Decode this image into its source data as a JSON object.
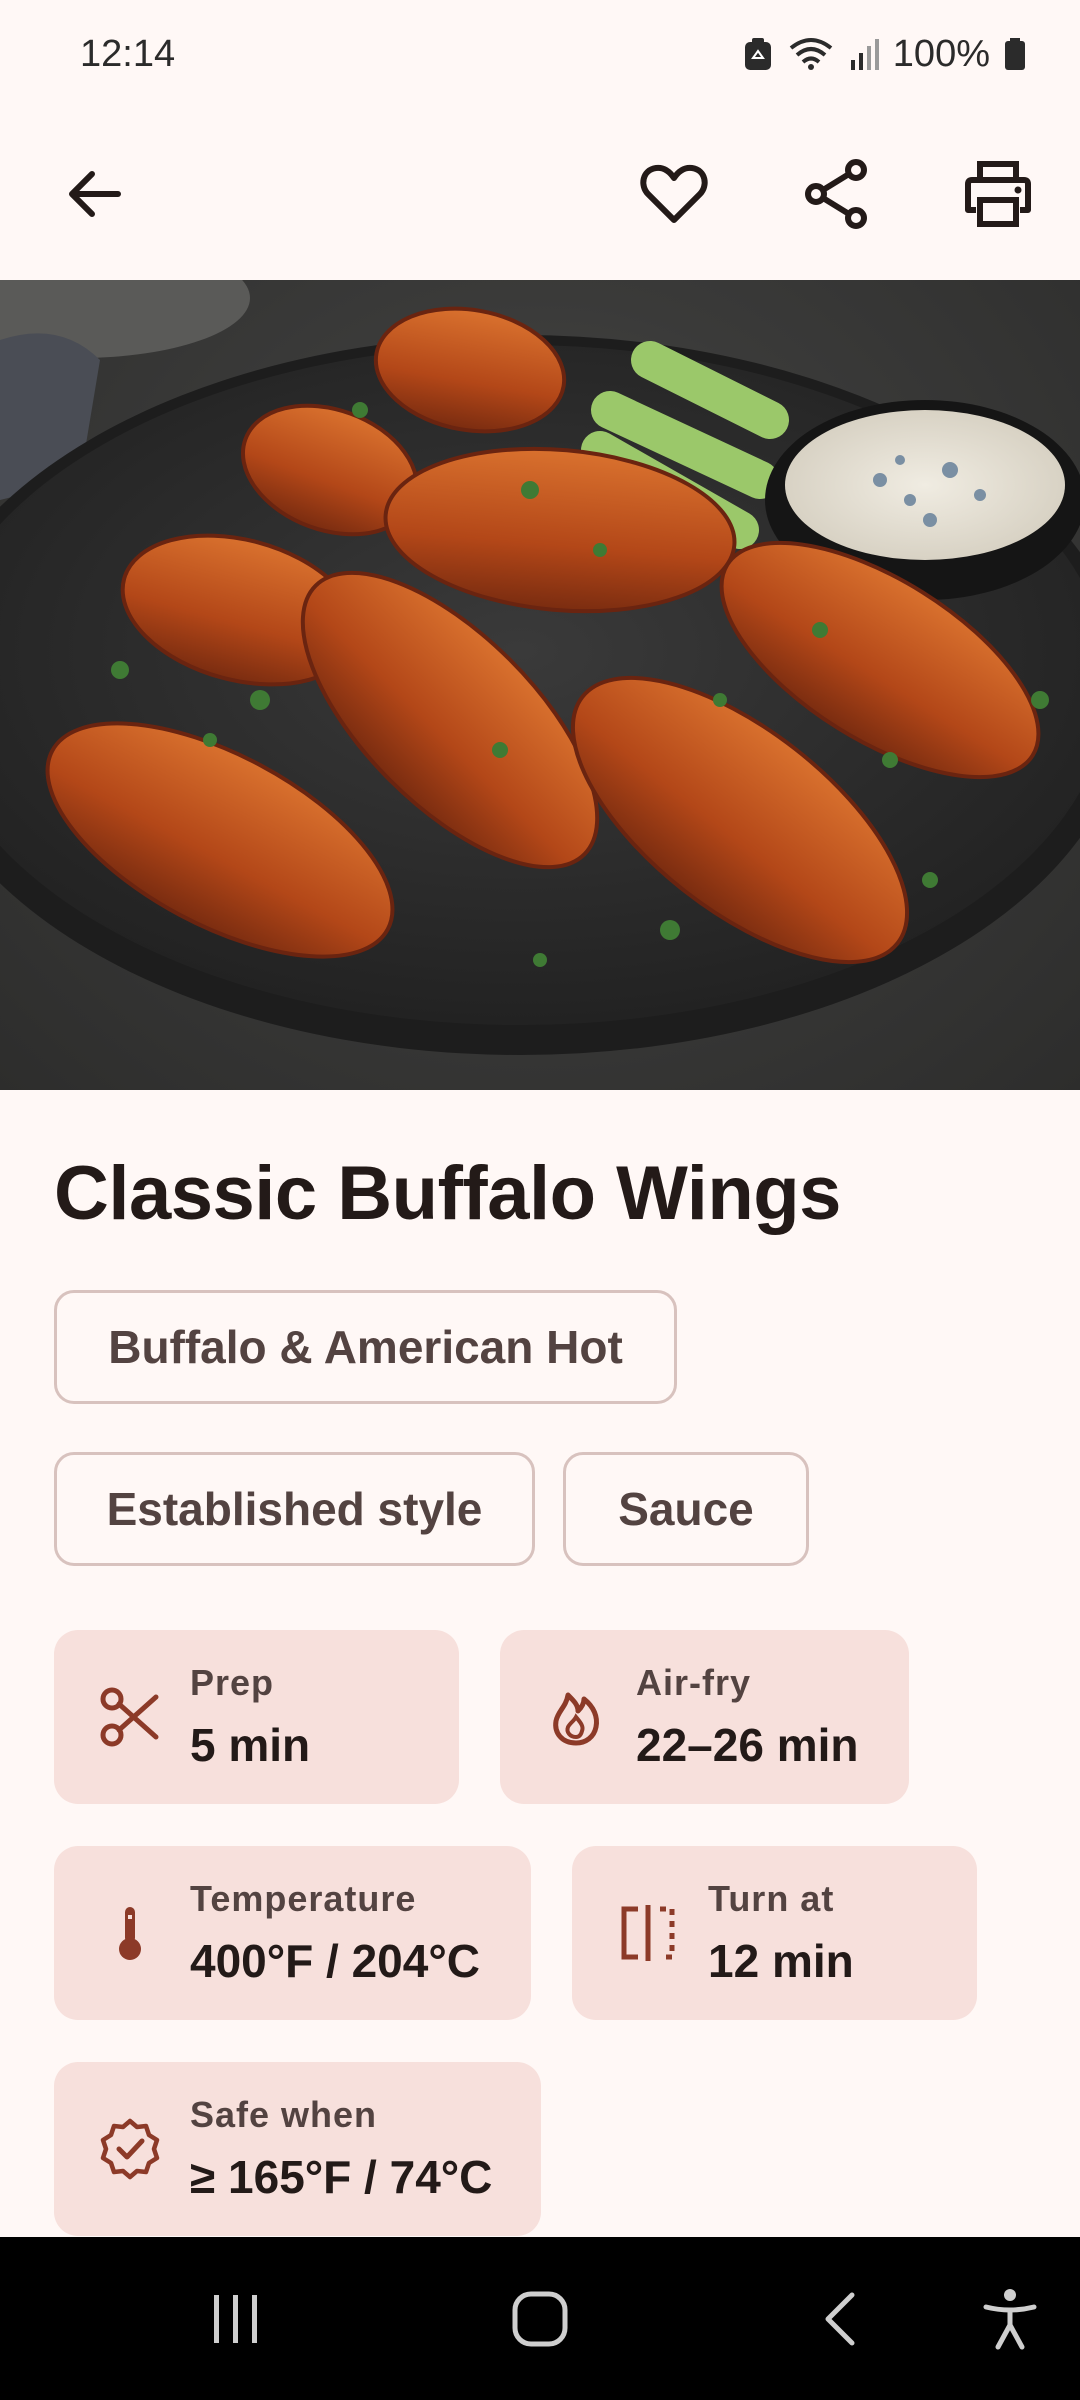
{
  "status_bar": {
    "time": "12:14",
    "battery": "100%"
  },
  "app_bar": {
    "icons": [
      "back-arrow-icon",
      "heart-icon",
      "share-icon",
      "print-icon"
    ]
  },
  "hero": {
    "image": "buffalo-wings-photo"
  },
  "recipe": {
    "title": "Classic Buffalo Wings",
    "chips": {
      "category": "Buffalo & American Hot",
      "style": "Established style",
      "type": "Sauce"
    },
    "info": {
      "prep": {
        "label": "Prep",
        "value": "5 min",
        "icon": "scissors-icon"
      },
      "airfry": {
        "label": "Air-fry",
        "value": "22–26 min",
        "icon": "flame-icon"
      },
      "temperature": {
        "label": "Temperature",
        "value": "400°F / 204°C",
        "icon": "thermometer-icon"
      },
      "turn": {
        "label": "Turn at",
        "value": "12 min",
        "icon": "flip-icon"
      },
      "safe": {
        "label": "Safe when",
        "value": "≥ 165°F / 74°C",
        "icon": "verified-badge-icon"
      }
    }
  },
  "colors": {
    "background": "#FFF8F6",
    "card": "#F7E0DC",
    "accent": "#8C3A28",
    "text": "#231A18",
    "chip_border": "#D8C2BE"
  }
}
